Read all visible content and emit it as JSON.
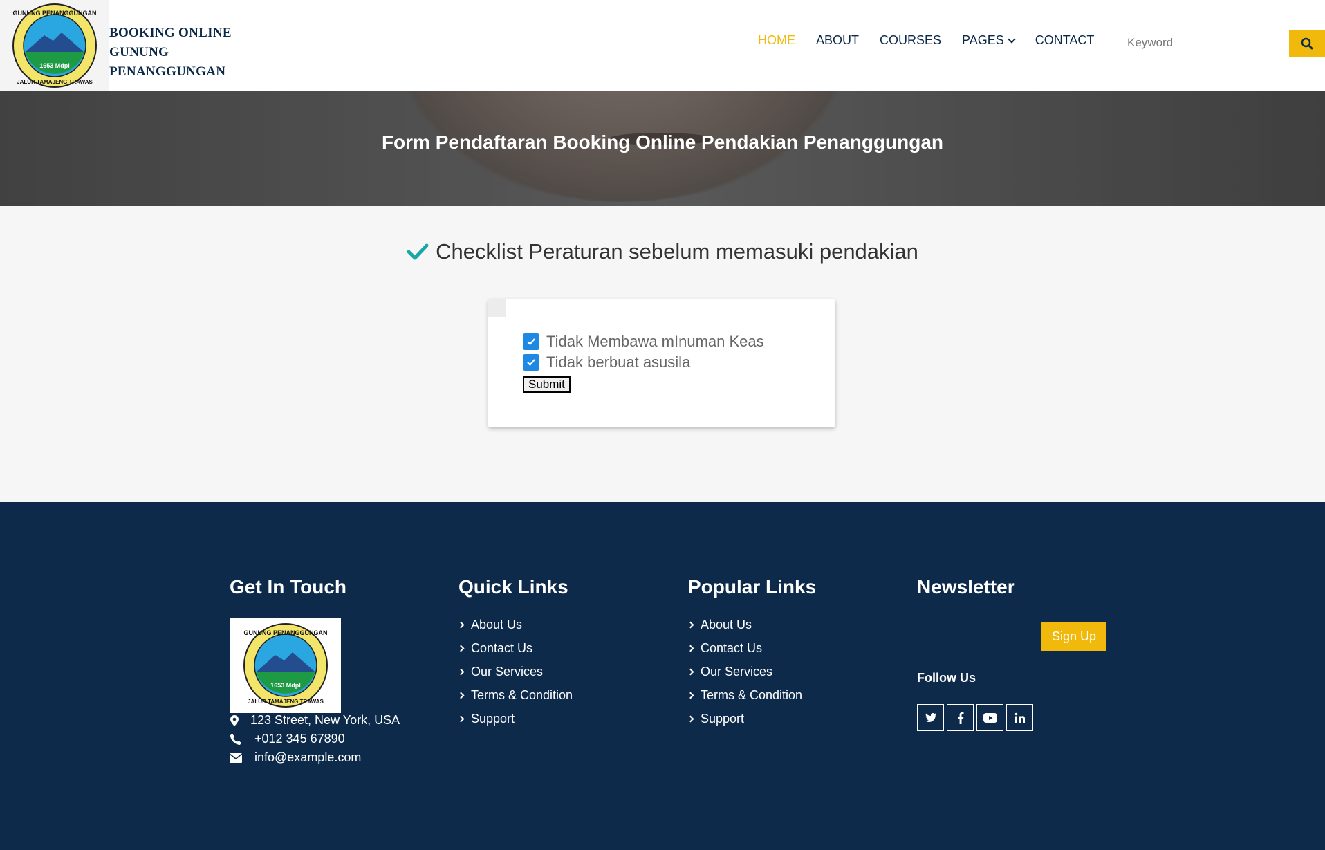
{
  "brand": {
    "line1": "BOOKING ONLINE",
    "line2": "GUNUNG",
    "line3": "PENANGGUNGAN",
    "logo_top_text": "GUNUNG PENANGGUNGAN",
    "logo_mid_text": "1653 Mdpl",
    "logo_bottom_text": "JALUR TAMAJENG TRAWAS"
  },
  "nav": {
    "items": [
      {
        "label": "HOME",
        "active": true
      },
      {
        "label": "ABOUT"
      },
      {
        "label": "COURSES"
      },
      {
        "label": "PAGES",
        "dropdown": true
      },
      {
        "label": "CONTACT"
      }
    ],
    "search_placeholder": "Keyword"
  },
  "hero": {
    "title": "Form Pendaftaran Booking Online Pendakian Penanggungan"
  },
  "checklist": {
    "heading": "Checklist Peraturan sebelum memasuki pendakian",
    "items": [
      {
        "label": "Tidak Membawa mInuman Keas",
        "checked": true
      },
      {
        "label": "Tidak berbuat asusila",
        "checked": true
      }
    ],
    "submit_label": "Submit"
  },
  "footer": {
    "contact": {
      "title": "Get In Touch",
      "address": "123 Street, New York, USA",
      "phone": "+012 345 67890",
      "email": "info@example.com"
    },
    "quick_links": {
      "title": "Quick Links",
      "items": [
        "About Us",
        "Contact Us",
        "Our Services",
        "Terms & Condition",
        "Support"
      ]
    },
    "popular_links": {
      "title": "Popular Links",
      "items": [
        "About Us",
        "Contact Us",
        "Our Services",
        "Terms & Condition",
        "Support"
      ]
    },
    "newsletter": {
      "title": "Newsletter",
      "signup_label": "Sign Up",
      "follow_label": "Follow Us",
      "social": [
        "twitter-icon",
        "facebook-icon",
        "youtube-icon",
        "linkedin-icon"
      ]
    }
  },
  "colors": {
    "accent": "#f0b90b",
    "navy": "#0d2a4a",
    "checkbox": "#1e88e5",
    "check_teal": "#1aa6a6"
  }
}
